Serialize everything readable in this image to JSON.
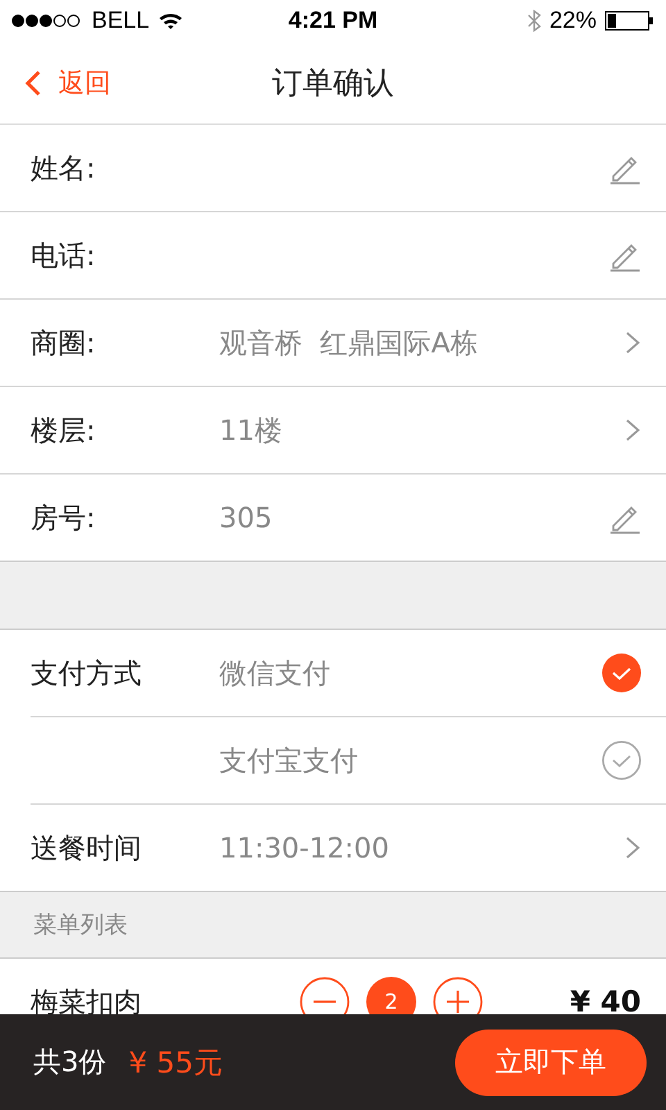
{
  "status_bar": {
    "carrier": "BELL",
    "time": "4:21 PM",
    "battery": "22%"
  },
  "nav": {
    "back": "返回",
    "title": "订单确认"
  },
  "contact_fields": [
    {
      "label": "姓名:",
      "kind": "edit"
    },
    {
      "label": "电话:",
      "kind": "edit"
    },
    {
      "label": "商圈:",
      "value": "观音桥  红鼎国际A栋",
      "kind": "select"
    },
    {
      "label": "楼层:",
      "value": "11楼",
      "kind": "select"
    },
    {
      "label": "房号:",
      "value": "305",
      "kind": "edit"
    }
  ],
  "payment": {
    "label": "支付方式",
    "options": [
      {
        "name": "微信支付",
        "selected": true
      },
      {
        "name": "支付宝支付",
        "selected": false
      }
    ]
  },
  "delivery": {
    "label": "送餐时间",
    "value": "11:30-12:00"
  },
  "menu": {
    "title": "菜单列表",
    "items": [
      {
        "name": "梅菜扣肉",
        "quantity": "2",
        "price": "¥ 40"
      }
    ]
  },
  "footer": {
    "count": "共3份",
    "total": "¥ 55元",
    "submit": "立即下单"
  }
}
